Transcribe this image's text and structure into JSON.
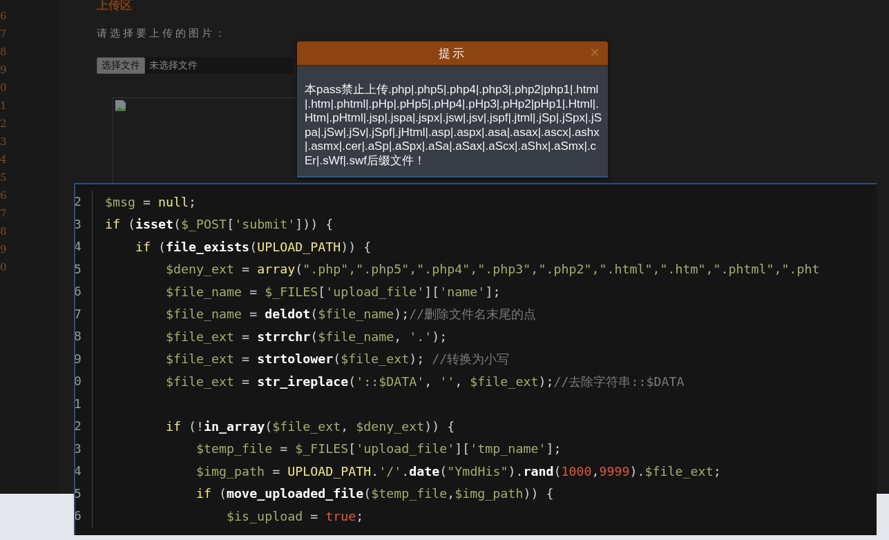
{
  "gutter": {
    "line_numbers": [
      "6",
      "7",
      "8",
      "9",
      "0",
      "1",
      "2",
      "3",
      "4",
      "5",
      "6",
      "7",
      "8",
      "9",
      "0"
    ]
  },
  "upload": {
    "heading": "上传区",
    "prompt": "请选择要上传的图片：",
    "file_button": "选择文件",
    "file_status": "未选择文件"
  },
  "dialog": {
    "title": "提示",
    "close": "×",
    "message": "本pass禁止上传.php|.php5|.php4|.php3|.php2|php1|.html|.htm|.phtml|.pHp|.pHp5|.pHp4|.pHp3|.pHp2|pHp1|.Html|.Htm|.pHtml|.jsp|.jspa|.jspx|.jsw|.jsv|.jspf|.jtml|.jSp|.jSpx|.jSpa|.jSw|.jSv|.jSpf|.jHtml|.asp|.aspx|.asa|.asax|.ascx|.ashx|.asmx|.cer|.aSp|.aSpx|.aSa|.aSax|.aScx|.aShx|.aSmx|.cEr|.sWf|.swf后缀文件！"
  },
  "editor": {
    "lines": [
      {
        "number": "2",
        "tokens": [
          {
            "kind": "var",
            "text": "$msg"
          },
          {
            "kind": "punct",
            "text": " = "
          },
          {
            "kind": "keyword",
            "text": "null"
          },
          {
            "kind": "punct",
            "text": ";"
          }
        ]
      },
      {
        "number": "3",
        "tokens": [
          {
            "kind": "keyword",
            "text": "if"
          },
          {
            "kind": "punct",
            "text": " ("
          },
          {
            "kind": "func",
            "text": "isset"
          },
          {
            "kind": "punct",
            "text": "("
          },
          {
            "kind": "var",
            "text": "$_POST"
          },
          {
            "kind": "punct",
            "text": "["
          },
          {
            "kind": "string",
            "text": "'submit'"
          },
          {
            "kind": "punct",
            "text": "])) {"
          }
        ]
      },
      {
        "number": "4",
        "tokens": [
          {
            "kind": "keyword",
            "text": "    if"
          },
          {
            "kind": "punct",
            "text": " ("
          },
          {
            "kind": "func",
            "text": "file_exists"
          },
          {
            "kind": "punct",
            "text": "("
          },
          {
            "kind": "keyword",
            "text": "UPLOAD_PATH"
          },
          {
            "kind": "punct",
            "text": ")) {"
          }
        ]
      },
      {
        "number": "5",
        "tokens": [
          {
            "kind": "var",
            "text": "        $deny_ext"
          },
          {
            "kind": "punct",
            "text": " = "
          },
          {
            "kind": "keyword",
            "text": "array"
          },
          {
            "kind": "punct",
            "text": "("
          },
          {
            "kind": "string",
            "text": "\".php\",\".php5\",\".php4\",\".php3\",\".php2\",\".html\",\".htm\",\".phtml\",\".pht"
          }
        ]
      },
      {
        "number": "6",
        "tokens": [
          {
            "kind": "var",
            "text": "        $file_name"
          },
          {
            "kind": "punct",
            "text": " = "
          },
          {
            "kind": "var",
            "text": "$_FILES"
          },
          {
            "kind": "punct",
            "text": "["
          },
          {
            "kind": "string",
            "text": "'upload_file'"
          },
          {
            "kind": "punct",
            "text": "]["
          },
          {
            "kind": "string",
            "text": "'name'"
          },
          {
            "kind": "punct",
            "text": "];"
          }
        ]
      },
      {
        "number": "7",
        "tokens": [
          {
            "kind": "var",
            "text": "        $file_name"
          },
          {
            "kind": "punct",
            "text": " = "
          },
          {
            "kind": "func",
            "text": "deldot"
          },
          {
            "kind": "punct",
            "text": "("
          },
          {
            "kind": "var",
            "text": "$file_name"
          },
          {
            "kind": "punct",
            "text": ");"
          },
          {
            "kind": "comment",
            "text": "//删除文件名末尾的点"
          }
        ]
      },
      {
        "number": "8",
        "tokens": [
          {
            "kind": "var",
            "text": "        $file_ext"
          },
          {
            "kind": "punct",
            "text": " = "
          },
          {
            "kind": "func",
            "text": "strrchr"
          },
          {
            "kind": "punct",
            "text": "("
          },
          {
            "kind": "var",
            "text": "$file_name"
          },
          {
            "kind": "punct",
            "text": ", "
          },
          {
            "kind": "string",
            "text": "'.'"
          },
          {
            "kind": "punct",
            "text": ");"
          }
        ]
      },
      {
        "number": "9",
        "tokens": [
          {
            "kind": "var",
            "text": "        $file_ext"
          },
          {
            "kind": "punct",
            "text": " = "
          },
          {
            "kind": "func",
            "text": "strtolower"
          },
          {
            "kind": "punct",
            "text": "("
          },
          {
            "kind": "var",
            "text": "$file_ext"
          },
          {
            "kind": "punct",
            "text": "); "
          },
          {
            "kind": "comment",
            "text": "//转换为小写"
          }
        ]
      },
      {
        "number": "0",
        "tokens": [
          {
            "kind": "var",
            "text": "        $file_ext"
          },
          {
            "kind": "punct",
            "text": " = "
          },
          {
            "kind": "func",
            "text": "str_ireplace"
          },
          {
            "kind": "punct",
            "text": "("
          },
          {
            "kind": "string",
            "text": "'::$DATA'"
          },
          {
            "kind": "punct",
            "text": ", "
          },
          {
            "kind": "string",
            "text": "''"
          },
          {
            "kind": "punct",
            "text": ", "
          },
          {
            "kind": "var",
            "text": "$file_ext"
          },
          {
            "kind": "punct",
            "text": ");"
          },
          {
            "kind": "comment",
            "text": "//去除字符串::$DATA"
          }
        ]
      },
      {
        "number": "1"
      },
      {
        "number": "2",
        "tokens": [
          {
            "kind": "keyword",
            "text": "        if"
          },
          {
            "kind": "punct",
            "text": " (!"
          },
          {
            "kind": "func",
            "text": "in_array"
          },
          {
            "kind": "punct",
            "text": "("
          },
          {
            "kind": "var",
            "text": "$file_ext"
          },
          {
            "kind": "punct",
            "text": ", "
          },
          {
            "kind": "var",
            "text": "$deny_ext"
          },
          {
            "kind": "punct",
            "text": ")) {"
          }
        ]
      },
      {
        "number": "3",
        "tokens": [
          {
            "kind": "var",
            "text": "            $temp_file"
          },
          {
            "kind": "punct",
            "text": " = "
          },
          {
            "kind": "var",
            "text": "$_FILES"
          },
          {
            "kind": "punct",
            "text": "["
          },
          {
            "kind": "string",
            "text": "'upload_file'"
          },
          {
            "kind": "punct",
            "text": "]["
          },
          {
            "kind": "string",
            "text": "'tmp_name'"
          },
          {
            "kind": "punct",
            "text": "];"
          }
        ]
      },
      {
        "number": "4",
        "tokens": [
          {
            "kind": "var",
            "text": "            $img_path"
          },
          {
            "kind": "punct",
            "text": " = "
          },
          {
            "kind": "keyword",
            "text": "UPLOAD_PATH"
          },
          {
            "kind": "punct",
            "text": "."
          },
          {
            "kind": "string",
            "text": "'/'"
          },
          {
            "kind": "punct",
            "text": "."
          },
          {
            "kind": "func",
            "text": "date"
          },
          {
            "kind": "punct",
            "text": "("
          },
          {
            "kind": "string",
            "text": "\"YmdHis\""
          },
          {
            "kind": "punct",
            "text": ")."
          },
          {
            "kind": "func",
            "text": "rand"
          },
          {
            "kind": "punct",
            "text": "("
          },
          {
            "kind": "number",
            "text": "1000"
          },
          {
            "kind": "punct",
            "text": ","
          },
          {
            "kind": "number",
            "text": "9999"
          },
          {
            "kind": "punct",
            "text": ")."
          },
          {
            "kind": "var",
            "text": "$file_ext"
          },
          {
            "kind": "punct",
            "text": ";"
          }
        ]
      },
      {
        "number": "5",
        "tokens": [
          {
            "kind": "keyword",
            "text": "            if"
          },
          {
            "kind": "punct",
            "text": " ("
          },
          {
            "kind": "func",
            "text": "move_uploaded_file"
          },
          {
            "kind": "punct",
            "text": "("
          },
          {
            "kind": "var",
            "text": "$temp_file"
          },
          {
            "kind": "punct",
            "text": ","
          },
          {
            "kind": "var",
            "text": "$img_path"
          },
          {
            "kind": "punct",
            "text": ")) {"
          }
        ]
      },
      {
        "number": "6",
        "tokens": [
          {
            "kind": "var",
            "text": "                $is_upload"
          },
          {
            "kind": "punct",
            "text": " = "
          },
          {
            "kind": "number",
            "text": "true"
          },
          {
            "kind": "punct",
            "text": ";"
          }
        ]
      }
    ]
  }
}
